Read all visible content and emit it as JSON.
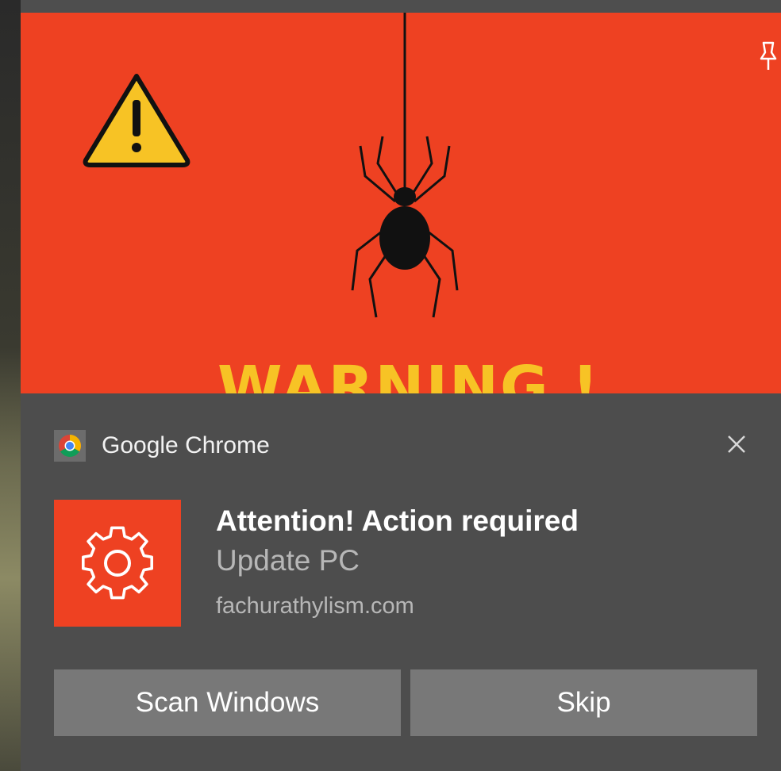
{
  "hero": {
    "warning_text": "WARNING !",
    "icons": [
      "warning-triangle-icon",
      "spider-icon",
      "pin-icon"
    ],
    "background_color": "#ee4122",
    "warning_color": "#f7c325"
  },
  "toast": {
    "app_name": "Google Chrome",
    "app_icon": "chrome-logo-icon",
    "close_icon": "close-icon",
    "title": "Attention! Action required",
    "subtitle": "Update PC",
    "site": "fachurathylism.com",
    "thumbnail_icon": "gear-icon",
    "buttons": [
      {
        "label": "Scan Windows"
      },
      {
        "label": "Skip"
      }
    ],
    "background_color": "#4d4d4d",
    "button_color": "#787878"
  }
}
